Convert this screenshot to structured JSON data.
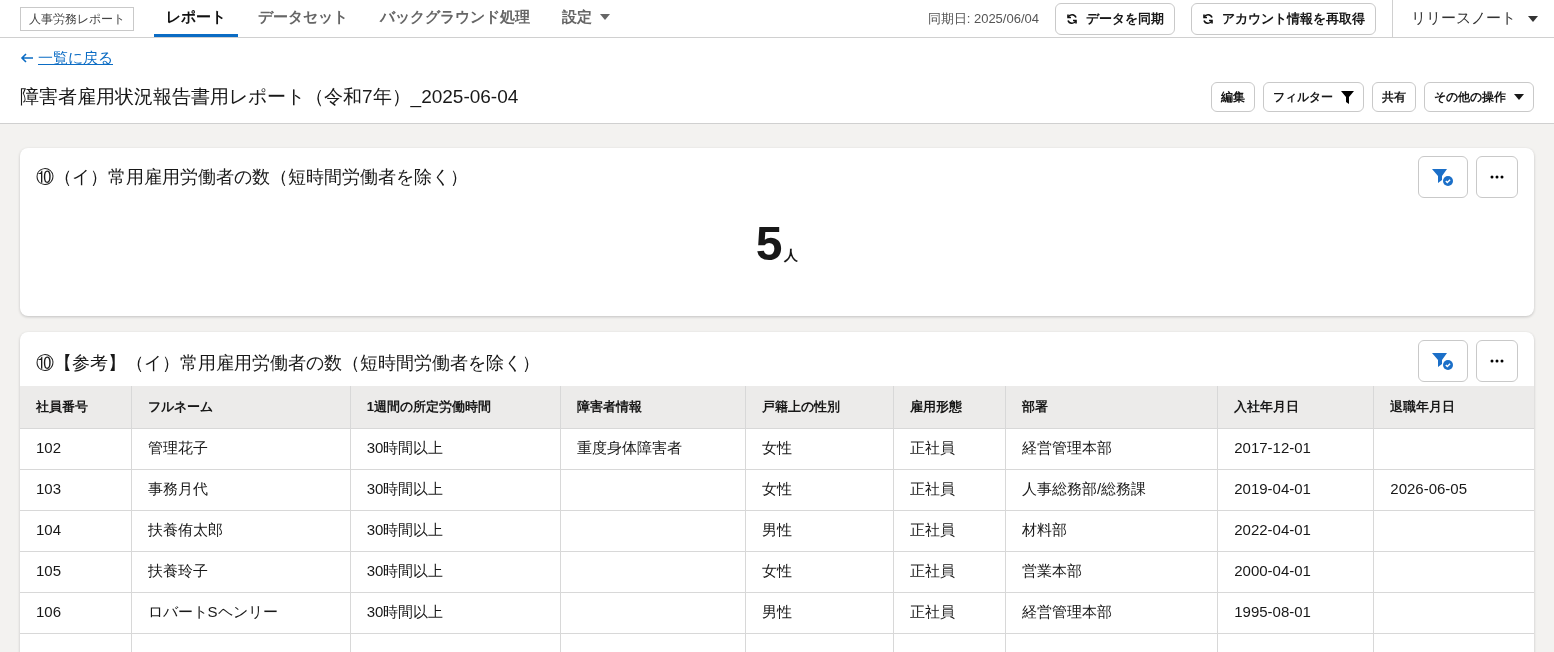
{
  "app_label": "人事労務レポート",
  "tabs": [
    {
      "label": "レポート",
      "selected": true,
      "kind": "plain"
    },
    {
      "label": "データセット",
      "selected": false,
      "kind": "plain"
    },
    {
      "label": "バックグラウンド処理",
      "selected": false,
      "kind": "plain"
    },
    {
      "label": "設定",
      "selected": false,
      "kind": "dropdown"
    }
  ],
  "sync_date": "同期日: 2025/06/04",
  "header_buttons": [
    "データを同期",
    "アカウント情報を再取得"
  ],
  "release_notes": "リリースノート",
  "back_link": "一覧に戻る",
  "report_title": "障害者雇用状況報告書用レポート（令和7年）_2025-06-04",
  "actions": [
    {
      "label": "編集",
      "kind": "plain"
    },
    {
      "label": "フィルター",
      "kind": "filter"
    },
    {
      "label": "共有",
      "kind": "plain"
    },
    {
      "label": "その他の操作",
      "kind": "dropdown"
    }
  ],
  "metric_card": {
    "title": "⑩（イ）常用雇用労働者の数（短時間労働者を除く）",
    "value": "5",
    "unit": "人"
  },
  "table_card": {
    "title": "⑩【参考】（イ）常用雇用労働者の数（短時間労働者を除く）",
    "columns": [
      "社員番号",
      "フルネーム",
      "1週間の所定労働時間",
      "障害者情報",
      "戸籍上の性別",
      "雇用形態",
      "部署",
      "入社年月日",
      "退職年月日"
    ],
    "rows": [
      [
        "102",
        "管理花子",
        "30時間以上",
        "重度身体障害者",
        "女性",
        "正社員",
        "経営管理本部",
        "2017-12-01",
        ""
      ],
      [
        "103",
        "事務月代",
        "30時間以上",
        "",
        "女性",
        "正社員",
        "人事総務部/総務課",
        "2019-04-01",
        "2026-06-05"
      ],
      [
        "104",
        "扶養侑太郎",
        "30時間以上",
        "",
        "男性",
        "正社員",
        "材料部",
        "2022-04-01",
        ""
      ],
      [
        "105",
        "扶養玲子",
        "30時間以上",
        "",
        "女性",
        "正社員",
        "営業本部",
        "2000-04-01",
        ""
      ],
      [
        "106",
        "ロバートSヘンリー",
        "30時間以上",
        "",
        "男性",
        "正社員",
        "経営管理本部",
        "1995-08-01",
        ""
      ]
    ]
  }
}
